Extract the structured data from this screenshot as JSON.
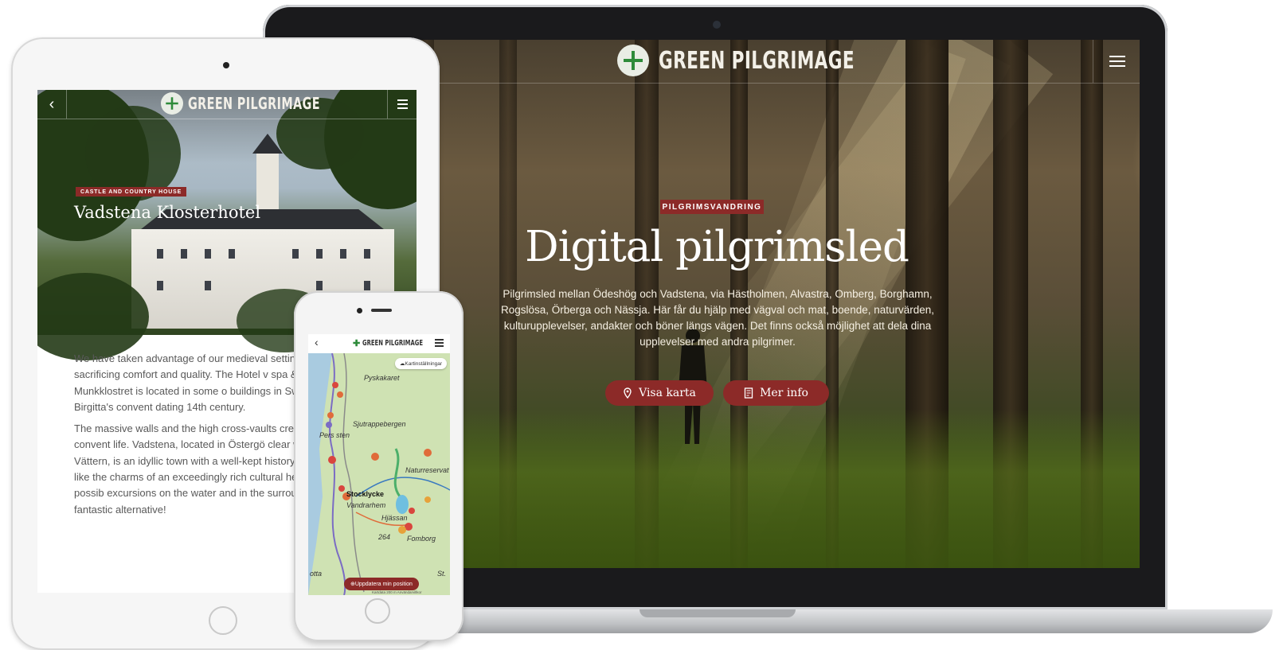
{
  "brand": {
    "name": "GREEN PILGRIMAGE",
    "accent": "#8c2a28",
    "logo_green": "#2e8b3a"
  },
  "laptop": {
    "badge": "PILGRIMSVANDRING",
    "title": "Digital pilgrimsled",
    "description": "Pilgrimsled mellan Ödeshög och Vadstena, via Hästholmen, Alvastra, Omberg, Borghamn, Rogslösa, Örberga och Nässja. Här får du hjälp med vägval och mat, boende, naturvärden, kulturupplevelser, andakter och böner längs vägen. Det finns också möjlighet att dela dina upplevelser med andra pilgrimer.",
    "buttons": {
      "map": "Visa karta",
      "info": "Mer info"
    },
    "icons": {
      "menu": "hamburger-icon",
      "map": "map-pin-icon",
      "info": "document-icon"
    }
  },
  "tablet": {
    "badge": "CASTLE AND COUNTRY HOUSE",
    "title": "Vadstena Klosterhotel",
    "paragraphs": [
      "We have taken advantage of our medieval setting i without sacrificing comfort and quality. The Hotel v spa & Restaurant Munkklostret is located in some o buildings in Sweden: Saint Birgitta's convent dating 14th century.",
      "The massive walls and the high cross-vaults create medieval convent life. Vadstena, located in Östergö clear water of Lake Vättern, is an idyllic town with a well-kept history. For those who like the charms of an exceedingly rich cultural heritage and the possib excursions on the water and in the surroundings, V fantastic alternative!"
    ]
  },
  "phone": {
    "map_settings": "Kartinställningar",
    "update_position": "Uppdatera min position",
    "credit": "Kartdata   200 m   Användarvillkor",
    "places": [
      "Pyskakaret",
      "Sjutrappebergen",
      "Pers sten",
      "Naturreservat",
      "Stocklycke",
      "Vandrarhem",
      "Hjässan",
      "264",
      "Fomborg",
      "otta",
      "St."
    ]
  }
}
